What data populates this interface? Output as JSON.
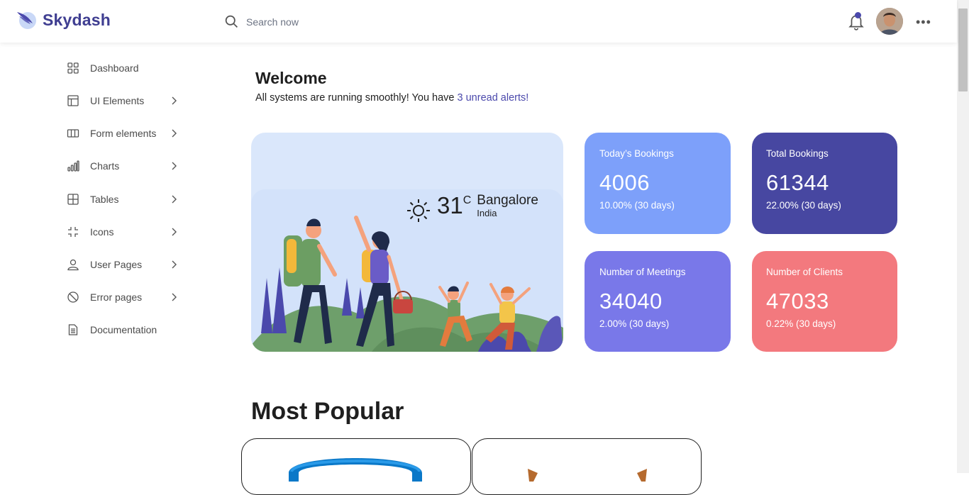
{
  "app": {
    "brand": "Skydash"
  },
  "header": {
    "search_placeholder": "Search now"
  },
  "sidebar": {
    "items": [
      {
        "label": "Dashboard",
        "icon": "grid-icon",
        "chevron": false
      },
      {
        "label": "UI Elements",
        "icon": "layout-icon",
        "chevron": true
      },
      {
        "label": "Form elements",
        "icon": "columns-icon",
        "chevron": true
      },
      {
        "label": "Charts",
        "icon": "bar-chart-icon",
        "chevron": true
      },
      {
        "label": "Tables",
        "icon": "table-icon",
        "chevron": true
      },
      {
        "label": "Icons",
        "icon": "minimize-icon",
        "chevron": true
      },
      {
        "label": "User Pages",
        "icon": "user-icon",
        "chevron": true
      },
      {
        "label": "Error pages",
        "icon": "ban-icon",
        "chevron": true
      },
      {
        "label": "Documentation",
        "icon": "document-icon",
        "chevron": false
      }
    ]
  },
  "main": {
    "welcome_title": "Welcome",
    "welcome_text": "All systems are running smoothly! You have ",
    "alert_link": "3 unread alerts!",
    "weather": {
      "temp": "31",
      "unit": "C",
      "city": "Bangalore",
      "country": "India",
      "icon": "sun-icon"
    },
    "stats": [
      {
        "title": "Today’s Bookings",
        "value": "4006",
        "change": "10.00% (30 days)",
        "color": "#7da0fa"
      },
      {
        "title": "Total Bookings",
        "value": "61344",
        "change": "22.00% (30 days)",
        "color": "#4747a1"
      },
      {
        "title": "Number of Meetings",
        "value": "34040",
        "change": "2.00% (30 days)",
        "color": "#7978e9"
      },
      {
        "title": "Number of Clients",
        "value": "47033",
        "change": "0.22% (30 days)",
        "color": "#f3797e"
      }
    ],
    "most_popular_title": "Most Popular"
  },
  "colors": {
    "accent": "#4b49ac",
    "hero_bg": "#dae7fb"
  }
}
